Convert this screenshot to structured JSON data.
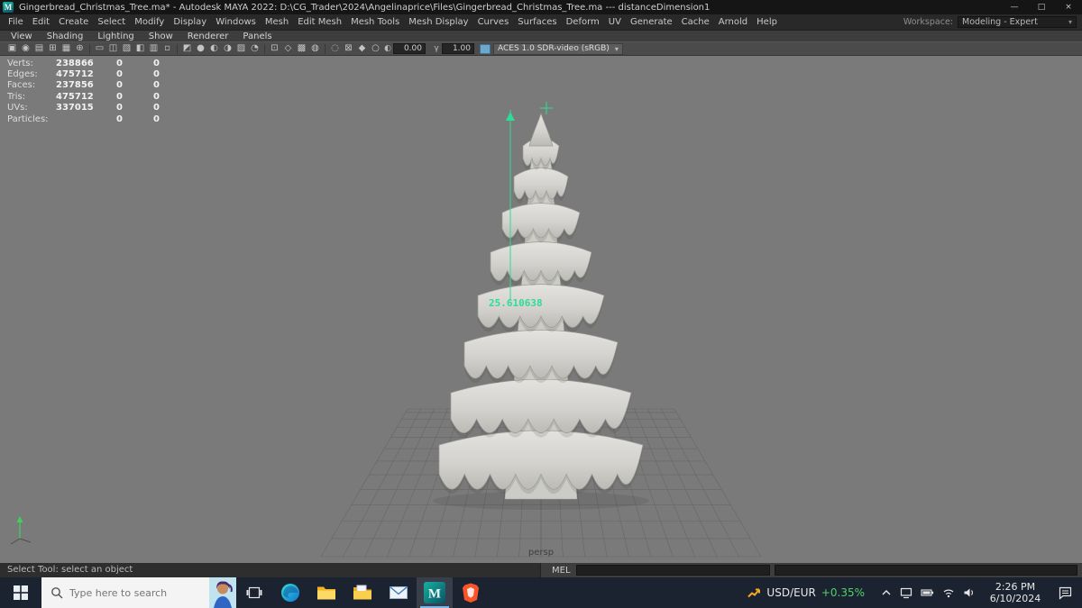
{
  "window": {
    "app_icon": "M",
    "title": "Gingerbread_Christmas_Tree.ma* - Autodesk MAYA 2022: D:\\CG_Trader\\2024\\Angelinaprice\\Files\\Gingerbread_Christmas_Tree.ma  ---  distanceDimension1",
    "minimize": "—",
    "maximize": "□",
    "close": "×"
  },
  "menubar": {
    "items": [
      "File",
      "Edit",
      "Create",
      "Select",
      "Modify",
      "Display",
      "Windows",
      "Mesh",
      "Edit Mesh",
      "Mesh Tools",
      "Mesh Display",
      "Curves",
      "Surfaces",
      "Deform",
      "UV",
      "Generate",
      "Cache",
      "Arnold",
      "Help"
    ],
    "workspace_label": "Workspace:",
    "workspace_value": "Modeling - Expert",
    "caret": "▾"
  },
  "panel_menubar": {
    "items": [
      "View",
      "Shading",
      "Lighting",
      "Show",
      "Renderer",
      "Panels"
    ]
  },
  "panel_toolbar": {
    "icons": [
      {
        "name": "lock-camera",
        "glyph": "▣"
      },
      {
        "name": "camera-attributes",
        "glyph": "◉"
      },
      {
        "name": "bookmarks",
        "glyph": "▤"
      },
      {
        "name": "image-plane",
        "glyph": "⊞"
      },
      {
        "name": "2d-pan-zoom",
        "glyph": "▦"
      },
      {
        "name": "grease-pencil",
        "glyph": "⊕"
      },
      {
        "name": "film-gate",
        "glyph": "▭"
      },
      {
        "name": "resolution-gate",
        "glyph": "◫"
      },
      {
        "name": "gate-mask",
        "glyph": "▧"
      },
      {
        "name": "field-chart",
        "glyph": "◧"
      },
      {
        "name": "safe-action",
        "glyph": "▥"
      },
      {
        "name": "safe-title",
        "glyph": "▫"
      },
      {
        "name": "wireframe-mode",
        "glyph": "◩"
      },
      {
        "name": "shaded-mode",
        "glyph": "●"
      },
      {
        "name": "textured-mode",
        "glyph": "◐"
      },
      {
        "name": "use-all-lights",
        "glyph": "◑"
      },
      {
        "name": "shadows",
        "glyph": "▨"
      },
      {
        "name": "screen-space-ao",
        "glyph": "◔"
      },
      {
        "name": "motion-blur",
        "glyph": "⊡"
      },
      {
        "name": "anti-aliasing",
        "glyph": "◇"
      },
      {
        "name": "depth-of-field",
        "glyph": "▩"
      },
      {
        "name": "isolate-select",
        "glyph": "◍"
      },
      {
        "name": "xray-mode",
        "glyph": "◌"
      },
      {
        "name": "wireframe-on-shaded",
        "glyph": "⊠"
      },
      {
        "name": "exposure-toggle",
        "glyph": "◆"
      },
      {
        "name": "gamma-toggle",
        "glyph": "○"
      }
    ],
    "exposure": "0.00",
    "gamma": "1.00",
    "colorspace": "ACES 1.0 SDR-video (sRGB)",
    "caret": "▾"
  },
  "hud": {
    "rows": [
      {
        "label": "Verts:",
        "c1": "238866",
        "c2": "0",
        "c3": "0"
      },
      {
        "label": "Edges:",
        "c1": "475712",
        "c2": "0",
        "c3": "0"
      },
      {
        "label": "Faces:",
        "c1": "237856",
        "c2": "0",
        "c3": "0"
      },
      {
        "label": "Tris:",
        "c1": "475712",
        "c2": "0",
        "c3": "0"
      },
      {
        "label": "UVs:",
        "c1": "337015",
        "c2": "0",
        "c3": "0"
      },
      {
        "label": "Particles:",
        "c1": "",
        "c2": "0",
        "c3": "0"
      }
    ]
  },
  "viewport": {
    "camera_label": "persp",
    "dimension_value": "25.610638",
    "accent_green": "#2edc96"
  },
  "helpline": {
    "text": "Select Tool: select an object"
  },
  "commandline": {
    "label": "MEL"
  },
  "taskbar": {
    "search_placeholder": "Type here to search",
    "stock_pair": "USD/EUR",
    "stock_change": "+0.35%",
    "time": "2:26 PM",
    "date": "6/10/2024"
  }
}
